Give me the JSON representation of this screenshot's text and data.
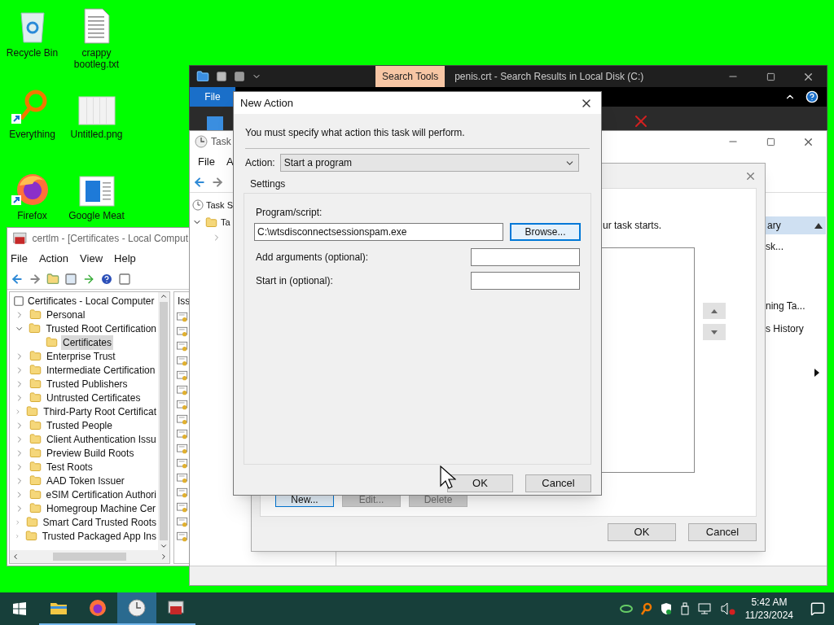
{
  "desktop_icons": [
    {
      "label": "Recycle Bin",
      "kind": "recycle",
      "shortcut": false
    },
    {
      "label": "crappy bootleg.txt",
      "kind": "text",
      "shortcut": false
    },
    {
      "label": "Everything",
      "kind": "search",
      "shortcut": true
    },
    {
      "label": "Untitled.png",
      "kind": "image",
      "shortcut": false
    },
    {
      "label": "Firefox",
      "kind": "firefox",
      "shortcut": true
    },
    {
      "label": "Google Meat",
      "kind": "document",
      "shortcut": false
    }
  ],
  "certlm": {
    "title": "certlm - [Certificates - Local Comput",
    "menu": [
      "File",
      "Action",
      "View",
      "Help"
    ],
    "root": "Certificates - Local Computer",
    "column_1": "Iss",
    "tree": [
      {
        "label": "Personal",
        "expanded": false
      },
      {
        "label": "Trusted Root Certification",
        "expanded": true,
        "children": [
          {
            "label": "Certificates",
            "selected": true
          }
        ]
      },
      {
        "label": "Enterprise Trust",
        "expanded": false
      },
      {
        "label": "Intermediate Certification",
        "expanded": false
      },
      {
        "label": "Trusted Publishers",
        "expanded": false
      },
      {
        "label": "Untrusted Certificates",
        "expanded": false
      },
      {
        "label": "Third-Party Root Certificat",
        "expanded": false
      },
      {
        "label": "Trusted People",
        "expanded": false
      },
      {
        "label": "Client Authentication Issu",
        "expanded": false
      },
      {
        "label": "Preview Build Roots",
        "expanded": false
      },
      {
        "label": "Test Roots",
        "expanded": false
      },
      {
        "label": "AAD Token Issuer",
        "expanded": false
      },
      {
        "label": "eSIM Certification Authori",
        "expanded": false
      },
      {
        "label": "Homegroup Machine Cer",
        "expanded": false
      },
      {
        "label": "Smart Card Trusted Roots",
        "expanded": false
      },
      {
        "label": "Trusted Packaged App Ins",
        "expanded": false
      }
    ]
  },
  "explorer": {
    "context_tab": "Search Tools",
    "title": "penis.crt - Search Results in Local Disk (C:)",
    "ribbon_tabs": [
      {
        "label": "File",
        "selected": true
      }
    ]
  },
  "task_scheduler": {
    "title": "Task",
    "menu": [
      "File",
      "A"
    ],
    "tree": [
      {
        "label": "Task S",
        "children": [
          {
            "label": "Ta",
            "expanded": true
          }
        ]
      }
    ]
  },
  "create_task_dialog": {
    "hint": "ur task starts.",
    "buttons": [
      {
        "label": "New...",
        "disabled": false
      },
      {
        "label": "Edit...",
        "disabled": true
      },
      {
        "label": "Delete",
        "disabled": true
      }
    ],
    "footer": [
      "OK",
      "Cancel"
    ]
  },
  "actions_pane": {
    "header": "ary",
    "items": [
      "sk...",
      "ning Ta...",
      "s History"
    ]
  },
  "new_action_dialog": {
    "title": "New Action",
    "instruction": "You must specify what action this task will perform.",
    "action_label": "Action:",
    "action_value": "Start a program",
    "settings_label": "Settings",
    "program_label": "Program/script:",
    "program_value": "C:\\wtsdisconnectsessionspam.exe",
    "browse": "Browse...",
    "arguments_label": "Add arguments (optional):",
    "start_in_label": "Start in (optional):",
    "buttons": [
      "OK",
      "Cancel"
    ]
  },
  "taskbar": {
    "apps": [
      {
        "kind": "explorer",
        "selected": false
      },
      {
        "kind": "firefox",
        "selected": false
      },
      {
        "kind": "clock",
        "selected": true
      },
      {
        "kind": "certlm",
        "selected": false
      }
    ],
    "time": "5:42 AM",
    "date": "11/23/2024"
  }
}
